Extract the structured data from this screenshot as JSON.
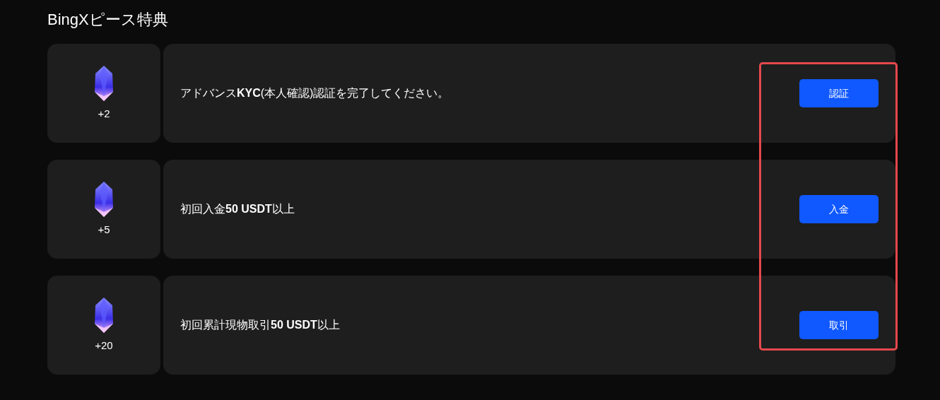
{
  "title": "BingXピース特典",
  "tasks": [
    {
      "reward": "+2",
      "description": "アドバンス**KYC**(本人確認)認証を完了してください。",
      "button": "認証"
    },
    {
      "reward": "+5",
      "description": "初回入金**50 USDT**以上",
      "button": "入金"
    },
    {
      "reward": "+20",
      "description": "初回累計現物取引**50 USDT**以上",
      "button": "取引"
    }
  ],
  "annotation": {
    "kind": "highlight-box",
    "color": "#e5484d"
  }
}
